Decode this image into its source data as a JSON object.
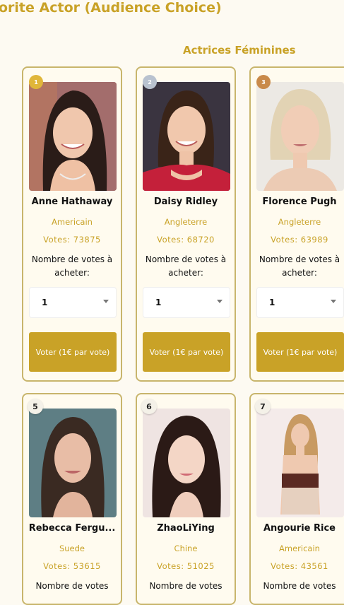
{
  "header": {
    "title": "orite Actor (Audience Choice)"
  },
  "section": {
    "title": "Actrices Féminines"
  },
  "cards": [
    {
      "rank": "1",
      "name": "Anne Hathaway",
      "country": "Americain",
      "votes": "Votes: 73875",
      "buy_label": "Nombre de votes à acheter:",
      "quantity": "1",
      "button": "Voter (1€ par vote)",
      "medal_color": "#e0b63a"
    },
    {
      "rank": "2",
      "name": "Daisy Ridley",
      "country": "Angleterre",
      "votes": "Votes: 68720",
      "buy_label": "Nombre de votes à acheter:",
      "quantity": "1",
      "button": "Voter (1€ par vote)",
      "medal_color": "#b9c2cf"
    },
    {
      "rank": "3",
      "name": "Florence Pugh",
      "country": "Angleterre",
      "votes": "Votes: 63989",
      "buy_label": "Nombre de votes à acheter:",
      "quantity": "1",
      "button": "Voter (1€ par vote)",
      "medal_color": "#c98a4a"
    },
    {
      "rank": "5",
      "name": "Rebecca Fergu...",
      "country": "Suede",
      "votes": "Votes: 53615",
      "buy_label": "Nombre de votes"
    },
    {
      "rank": "6",
      "name": "ZhaoLiYing",
      "country": "Chine",
      "votes": "Votes: 51025",
      "buy_label": "Nombre de votes"
    },
    {
      "rank": "7",
      "name": "Angourie Rice",
      "country": "Americain",
      "votes": "Votes: 43561",
      "buy_label": "Nombre de votes"
    }
  ],
  "colors": {
    "accent": "#c9a227",
    "card_border": "#c8b56c",
    "background": "#fdfaf2"
  }
}
